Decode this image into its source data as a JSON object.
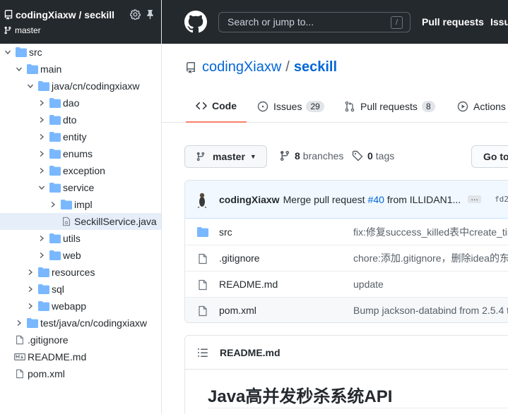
{
  "sidebar": {
    "repo": "codingXiaxw / seckill",
    "branch": "master",
    "tree": [
      {
        "label": "src",
        "type": "folder",
        "depth": 0,
        "open": true
      },
      {
        "label": "main",
        "type": "folder",
        "depth": 1,
        "open": true
      },
      {
        "label": "java/cn/codingxiaxw",
        "type": "folder",
        "depth": 2,
        "open": true
      },
      {
        "label": "dao",
        "type": "folder",
        "depth": 3,
        "open": false
      },
      {
        "label": "dto",
        "type": "folder",
        "depth": 3,
        "open": false
      },
      {
        "label": "entity",
        "type": "folder",
        "depth": 3,
        "open": false
      },
      {
        "label": "enums",
        "type": "folder",
        "depth": 3,
        "open": false
      },
      {
        "label": "exception",
        "type": "folder",
        "depth": 3,
        "open": false
      },
      {
        "label": "service",
        "type": "folder",
        "depth": 3,
        "open": true
      },
      {
        "label": "impl",
        "type": "folder",
        "depth": 4,
        "open": false
      },
      {
        "label": "SeckillService.java",
        "type": "java",
        "depth": 4,
        "selected": true
      },
      {
        "label": "utils",
        "type": "folder",
        "depth": 3,
        "open": false
      },
      {
        "label": "web",
        "type": "folder",
        "depth": 3,
        "open": false
      },
      {
        "label": "resources",
        "type": "folder",
        "depth": 2,
        "open": false
      },
      {
        "label": "sql",
        "type": "folder",
        "depth": 2,
        "open": false
      },
      {
        "label": "webapp",
        "type": "folder",
        "depth": 2,
        "open": false
      },
      {
        "label": "test/java/cn/codingxiaxw",
        "type": "folder",
        "depth": 1,
        "open": false
      },
      {
        "label": ".gitignore",
        "type": "file",
        "depth": 0
      },
      {
        "label": "README.md",
        "type": "markdown",
        "depth": 0
      },
      {
        "label": "pom.xml",
        "type": "file",
        "depth": 0
      }
    ]
  },
  "header": {
    "search_placeholder": "Search or jump to...",
    "search_shortcut": "/",
    "nav": [
      "Pull requests",
      "Issu"
    ]
  },
  "repo": {
    "owner": "codingXiaxw",
    "separator": "/",
    "name": "seckill"
  },
  "tabs": [
    {
      "label": "Code",
      "count": "",
      "icon": "code-icon",
      "active": true
    },
    {
      "label": "Issues",
      "count": "29",
      "icon": "issue-icon"
    },
    {
      "label": "Pull requests",
      "count": "8",
      "icon": "pull-request-icon"
    },
    {
      "label": "Actions",
      "count": "",
      "icon": "play-icon"
    }
  ],
  "toolbar": {
    "branch": "master",
    "branches_count": "8",
    "branches_label": "branches",
    "tags_count": "0",
    "tags_label": "tags",
    "goto_label": "Go to"
  },
  "commit": {
    "author": "codingXiaxw",
    "message_prefix": "Merge pull request",
    "pr": "#40",
    "message_suffix": "from ILLIDAN1...",
    "ellipsis": "…",
    "sha": "fd2"
  },
  "files": [
    {
      "name": "src",
      "type": "folder",
      "message": "fix:修复success_killed表中create_tim"
    },
    {
      "name": ".gitignore",
      "type": "file",
      "message": "chore:添加.gitignore，删除idea的东"
    },
    {
      "name": "README.md",
      "type": "file",
      "message": "update"
    },
    {
      "name": "pom.xml",
      "type": "file",
      "message": "Bump jackson-databind from 2.5.4 t"
    }
  ],
  "readme": {
    "title": "README.md",
    "heading": "Java高并发秒杀系统API"
  },
  "colors": {
    "header_bg": "#24292e",
    "link": "#0366d6",
    "folder": "#79b8ff",
    "active_tab": "#f9826c",
    "selected_row": "#e6eef9"
  }
}
